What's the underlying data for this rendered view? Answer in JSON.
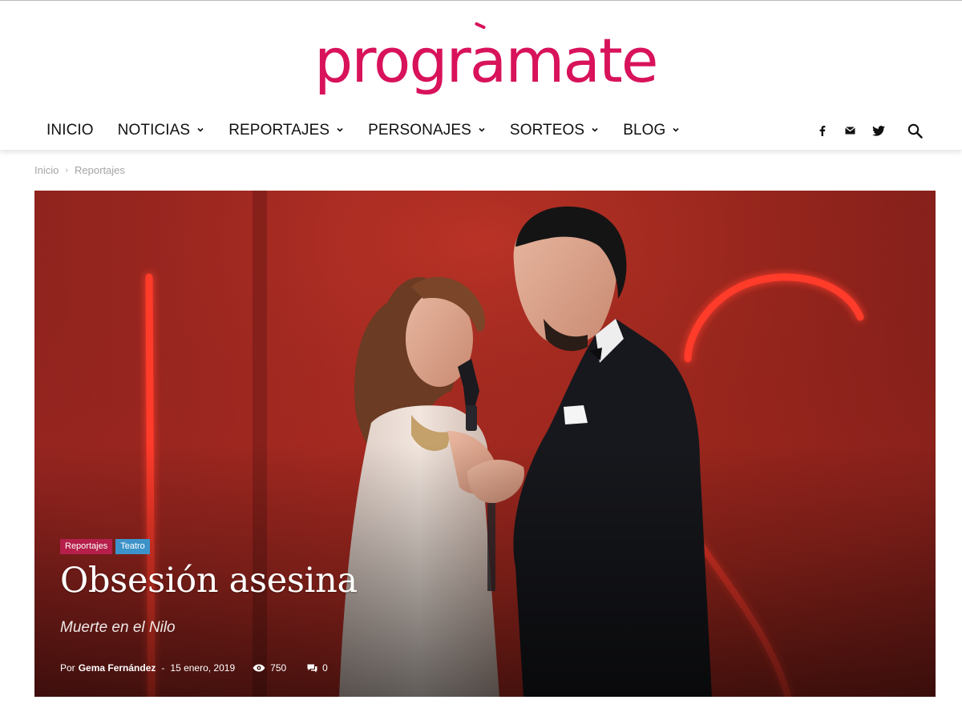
{
  "brand": {
    "name": "programate",
    "color": "#d8125b"
  },
  "nav": {
    "items": [
      {
        "label": "INICIO",
        "dropdown": false
      },
      {
        "label": "NOTICIAS",
        "dropdown": true
      },
      {
        "label": "REPORTAJES",
        "dropdown": true
      },
      {
        "label": "PERSONAJES",
        "dropdown": true
      },
      {
        "label": "SORTEOS",
        "dropdown": true
      },
      {
        "label": "BLOG",
        "dropdown": true
      }
    ],
    "social": [
      "facebook-icon",
      "mail-icon",
      "twitter-icon"
    ],
    "search": "search-icon"
  },
  "breadcrumb": {
    "home": "Inicio",
    "current": "Reportajes"
  },
  "article": {
    "categories": [
      {
        "label": "Reportajes",
        "color": "#b51f4a"
      },
      {
        "label": "Teatro",
        "color": "#3d93c9"
      }
    ],
    "title": "Obsesión asesina",
    "subtitle": "Muerte en el Nilo",
    "by": "Por",
    "author": "Gema Fernández",
    "separator": "-",
    "date": "15 enero, 2019",
    "views": "750",
    "comments": "0"
  }
}
